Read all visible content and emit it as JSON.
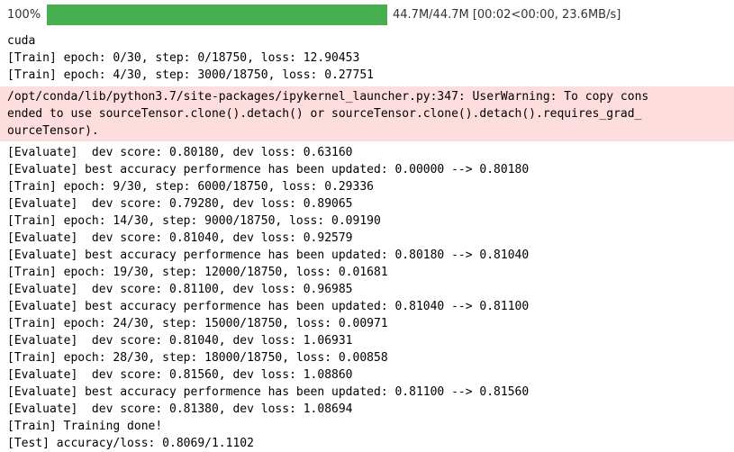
{
  "progress": {
    "percent_label": "100%",
    "fraction": 1.0,
    "info": "44.7M/44.7M [00:02<00:00, 23.6MB/s]",
    "fill_color": "#47af50"
  },
  "output_before": [
    "cuda",
    "[Train] epoch: 0/30, step: 0/18750, loss: 12.90453",
    "[Train] epoch: 4/30, step: 3000/18750, loss: 0.27751"
  ],
  "warning": {
    "lines": [
      "/opt/conda/lib/python3.7/site-packages/ipykernel_launcher.py:347: UserWarning: To copy cons",
      "ended to use sourceTensor.clone().detach() or sourceTensor.clone().detach().requires_grad_",
      "ourceTensor)."
    ],
    "background": "#fddddd"
  },
  "output_after": [
    "[Evaluate]  dev score: 0.80180, dev loss: 0.63160",
    "[Evaluate] best accuracy performence has been updated: 0.00000 --> 0.80180",
    "[Train] epoch: 9/30, step: 6000/18750, loss: 0.29336",
    "[Evaluate]  dev score: 0.79280, dev loss: 0.89065",
    "[Train] epoch: 14/30, step: 9000/18750, loss: 0.09190",
    "[Evaluate]  dev score: 0.81040, dev loss: 0.92579",
    "[Evaluate] best accuracy performence has been updated: 0.80180 --> 0.81040",
    "[Train] epoch: 19/30, step: 12000/18750, loss: 0.01681",
    "[Evaluate]  dev score: 0.81100, dev loss: 0.96985",
    "[Evaluate] best accuracy performence has been updated: 0.81040 --> 0.81100",
    "[Train] epoch: 24/30, step: 15000/18750, loss: 0.00971",
    "[Evaluate]  dev score: 0.81040, dev loss: 1.06931",
    "[Train] epoch: 28/30, step: 18000/18750, loss: 0.00858",
    "[Evaluate]  dev score: 0.81560, dev loss: 1.08860",
    "[Evaluate] best accuracy performence has been updated: 0.81100 --> 0.81560",
    "[Evaluate]  dev score: 0.81380, dev loss: 1.08694",
    "[Train] Training done!",
    "[Test] accuracy/loss: 0.8069/1.1102"
  ]
}
